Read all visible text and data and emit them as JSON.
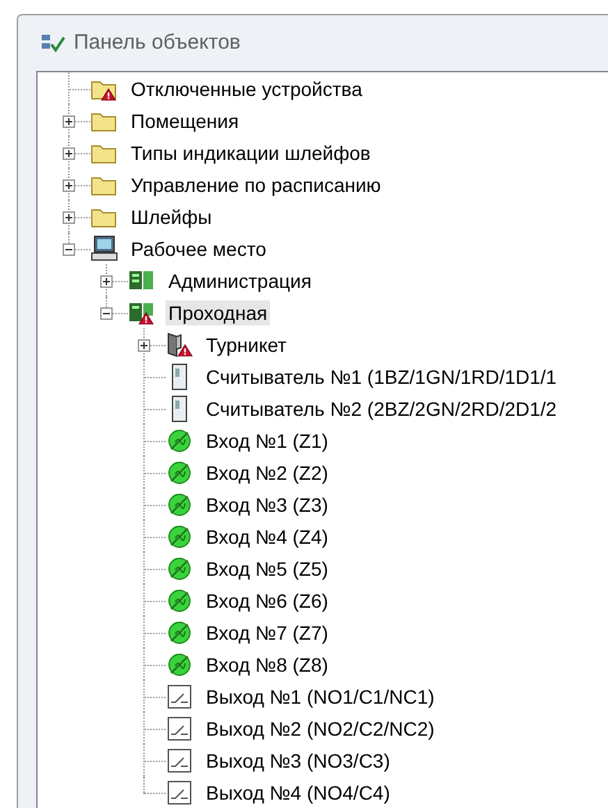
{
  "panel": {
    "title": "Панель объектов"
  },
  "tree": [
    {
      "kind": "alarm-folder",
      "label": "Отключенные устройства",
      "selected": false
    },
    {
      "kind": "folder",
      "label": "Помещения",
      "expanded": false,
      "selected": false
    },
    {
      "kind": "folder",
      "label": "Типы индикации шлейфов",
      "expanded": false,
      "selected": false
    },
    {
      "kind": "folder",
      "label": "Управление по расписанию",
      "expanded": false,
      "selected": false
    },
    {
      "kind": "folder",
      "label": "Шлейфы",
      "expanded": false,
      "selected": false
    },
    {
      "kind": "computer",
      "label": "Рабочее место",
      "expanded": true,
      "selected": false,
      "children": [
        {
          "kind": "panel",
          "label": "Администрация",
          "expanded": false,
          "selected": false
        },
        {
          "kind": "panel-alarm",
          "label": "Проходная",
          "expanded": true,
          "selected": true,
          "children": [
            {
              "kind": "turnstile",
              "label": "Турникет",
              "expanded": false,
              "selected": false
            },
            {
              "kind": "reader",
              "label": "Считыватель №1 (1BZ/1GN/1RD/1D1/1",
              "selected": false
            },
            {
              "kind": "reader",
              "label": "Считыватель №2 (2BZ/2GN/2RD/2D1/2",
              "selected": false
            },
            {
              "kind": "input",
              "label": "Вход №1 (Z1)",
              "selected": false
            },
            {
              "kind": "input",
              "label": "Вход №2 (Z2)",
              "selected": false
            },
            {
              "kind": "input",
              "label": "Вход №3 (Z3)",
              "selected": false
            },
            {
              "kind": "input",
              "label": "Вход №4 (Z4)",
              "selected": false
            },
            {
              "kind": "input",
              "label": "Вход №5 (Z5)",
              "selected": false
            },
            {
              "kind": "input",
              "label": "Вход №6 (Z6)",
              "selected": false
            },
            {
              "kind": "input",
              "label": "Вход №7 (Z7)",
              "selected": false
            },
            {
              "kind": "input",
              "label": "Вход №8 (Z8)",
              "selected": false
            },
            {
              "kind": "output",
              "label": "Выход №1 (NO1/C1/NC1)",
              "selected": false
            },
            {
              "kind": "output",
              "label": "Выход №2 (NO2/C2/NC2)",
              "selected": false
            },
            {
              "kind": "output",
              "label": "Выход №3 (NO3/C3)",
              "selected": false
            },
            {
              "kind": "output",
              "label": "Выход №4 (NO4/C4)",
              "selected": false
            }
          ]
        }
      ]
    }
  ]
}
